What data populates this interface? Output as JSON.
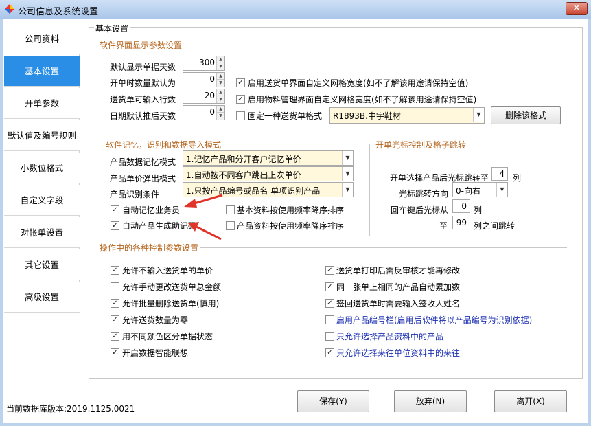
{
  "window": {
    "title": "公司信息及系统设置",
    "close": "✕"
  },
  "sidebar": {
    "items": [
      {
        "label": "公司资料"
      },
      {
        "label": "基本设置"
      },
      {
        "label": "开单参数"
      },
      {
        "label": "默认值及编号规则"
      },
      {
        "label": "小数位格式"
      },
      {
        "label": "自定义字段"
      },
      {
        "label": "对帐单设置"
      },
      {
        "label": "其它设置"
      },
      {
        "label": "高级设置"
      }
    ],
    "active_index": 1
  },
  "main": {
    "title": "基本设置"
  },
  "ui_section": {
    "title": "软件界面显示参数设置",
    "fields": [
      {
        "label": "默认显示单据天数",
        "value": "300"
      },
      {
        "label": "开单时数量默认为",
        "value": "0"
      },
      {
        "label": "送货单可输入行数",
        "value": "20"
      },
      {
        "label": "日期默认推后天数",
        "value": "0"
      }
    ],
    "options": [
      {
        "label": "启用送货单界面自定义网格宽度(如不了解该用途请保持空值)",
        "checked": true
      },
      {
        "label": "启用物料管理界面自定义网格宽度(如不了解该用途请保持空值)",
        "checked": true
      },
      {
        "label": "固定一种送货单格式",
        "checked": false
      }
    ],
    "format_value": "R1893B.中宇鞋材",
    "delete_format_button": "删除该格式"
  },
  "memory_section": {
    "title": "软件记忆，识别和数据导入模式",
    "rows": [
      {
        "label": "产品数据记忆模式",
        "value": "1.记忆产品和分开客户记忆单价"
      },
      {
        "label": "产品单价弹出模式",
        "value": "1.自动按不同客户跳出上次单价"
      },
      {
        "label": "产品识别条件",
        "value": "1.只按产品编号或品名 单项识别产品"
      }
    ],
    "checks": [
      {
        "label": "自动记忆业务员",
        "checked": true
      },
      {
        "label": "基本资料按使用频率降序排序",
        "checked": false
      },
      {
        "label": "自动产品生成助记码",
        "checked": true
      },
      {
        "label": "产品资料按使用频率降序排序",
        "checked": false
      }
    ]
  },
  "cursor_section": {
    "title": "开单光标控制及格子跳转",
    "jump_label": "开单选择产品后光标跳转至",
    "jump_value": "4",
    "jump_unit": "列",
    "direction_label": "光标跳转方向",
    "direction_value": "0-向右",
    "enter_label": "回车键后光标从",
    "enter_from": "0",
    "enter_from_unit": "列",
    "enter_to_label": "至",
    "enter_to": "99",
    "enter_to_unit": "列之间跳转"
  },
  "control_section": {
    "title": "操作中的各种控制参数设置",
    "left": [
      {
        "label": "允许不输入送货单的单价",
        "checked": true
      },
      {
        "label": "允许手动更改送货单总金额",
        "checked": false
      },
      {
        "label": "允许批量删除送货单(慎用)",
        "checked": true
      },
      {
        "label": "允许送货数量为零",
        "checked": true
      },
      {
        "label": "用不同颜色区分单据状态",
        "checked": true
      },
      {
        "label": "开启数据智能联想",
        "checked": true
      }
    ],
    "right": [
      {
        "label": "送货单打印后需反审核才能再修改",
        "checked": true
      },
      {
        "label": "同一张单上相同的产品自动累加数",
        "checked": true
      },
      {
        "label": "签回送货单时需要输入签收人姓名",
        "checked": true
      },
      {
        "label": "启用产品编号栏(启用后软件将以产品编号为识别依据)",
        "checked": false
      },
      {
        "label": "只允许选择产品资料中的产品",
        "checked": false
      },
      {
        "label": "只允许选择来往单位资料中的来往",
        "checked": true
      }
    ]
  },
  "footer": {
    "db_version": "当前数据库版本:2019.1125.0021",
    "save_button": "保存(Y)",
    "discard_button": "放弃(N)",
    "exit_button": "离开(X)"
  },
  "colors": {
    "accent": "#2a8de6",
    "group_title": "#b5651d",
    "arrow": "#e0342a",
    "blue_text": "#1b2fb0"
  }
}
